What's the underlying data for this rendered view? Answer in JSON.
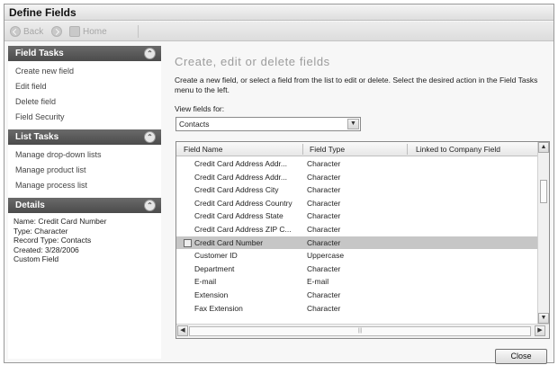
{
  "window": {
    "title": "Define Fields"
  },
  "nav": {
    "back": "Back",
    "home": "Home"
  },
  "sidebar": {
    "field_tasks": {
      "title": "Field Tasks",
      "items": [
        "Create new field",
        "Edit field",
        "Delete field",
        "Field Security"
      ]
    },
    "list_tasks": {
      "title": "List Tasks",
      "items": [
        "Manage drop-down lists",
        "Manage product list",
        "Manage process list"
      ]
    },
    "details": {
      "title": "Details",
      "lines": [
        "Name: Credit Card Number",
        "Type: Character",
        "Record Type: Contacts",
        "Created: 3/28/2006",
        "Custom Field"
      ]
    }
  },
  "main": {
    "heading": "Create, edit or delete fields",
    "instructions": "Create a new field, or select a field from the list to edit or delete. Select the desired action in the Field Tasks menu to the left.",
    "view_label": "View fields for:",
    "view_value": "Contacts"
  },
  "grid": {
    "columns": [
      "Field Name",
      "Field Type",
      "Linked to Company Field"
    ],
    "rows": [
      {
        "name": "Credit Card Address Addr...",
        "type": "Character",
        "selected": false
      },
      {
        "name": "Credit Card Address Addr...",
        "type": "Character",
        "selected": false
      },
      {
        "name": "Credit Card Address City",
        "type": "Character",
        "selected": false
      },
      {
        "name": "Credit Card Address Country",
        "type": "Character",
        "selected": false
      },
      {
        "name": "Credit Card Address State",
        "type": "Character",
        "selected": false
      },
      {
        "name": "Credit Card Address ZIP C...",
        "type": "Character",
        "selected": false
      },
      {
        "name": "Credit Card Number",
        "type": "Character",
        "selected": true
      },
      {
        "name": "Customer ID",
        "type": "Uppercase",
        "selected": false
      },
      {
        "name": "Department",
        "type": "Character",
        "selected": false
      },
      {
        "name": "E-mail",
        "type": "E-mail",
        "selected": false
      },
      {
        "name": "Extension",
        "type": "Character",
        "selected": false
      },
      {
        "name": "Fax Extension",
        "type": "Character",
        "selected": false
      }
    ]
  },
  "footer": {
    "close": "Close"
  }
}
